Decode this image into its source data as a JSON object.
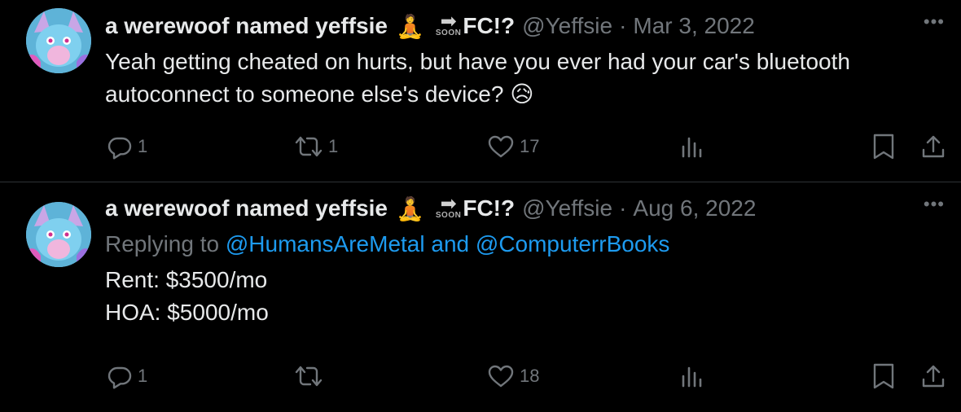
{
  "tweets": [
    {
      "display_name": "a werewoof named yeffsie",
      "name_emoji": "🧘",
      "soon_arrow": "➡",
      "soon_text": "SOON",
      "fc_text": "FC!?",
      "handle": "@Yeffsie",
      "separator": "·",
      "date": "Mar 3, 2022",
      "more": "•••",
      "text": "Yeah getting cheated on hurts, but have you ever had your car's bluetooth autoconnect to someone else's device? 😥",
      "replies": "1",
      "retweets": "1",
      "likes": "17"
    },
    {
      "display_name": "a werewoof named yeffsie",
      "name_emoji": "🧘",
      "soon_arrow": "➡",
      "soon_text": "SOON",
      "fc_text": "FC!?",
      "handle": "@Yeffsie",
      "separator": "·",
      "date": "Aug 6, 2022",
      "more": "•••",
      "replying_prefix": "Replying to ",
      "replying_mention_1": "@HumansAreMetal",
      "replying_and": " and ",
      "replying_mention_2": "@ComputerrBooks",
      "text_line_1": "Rent: $3500/mo",
      "text_line_2": "HOA: $5000/mo",
      "replies": "1",
      "retweets": "",
      "likes": "18"
    }
  ],
  "colors": {
    "background": "#000000",
    "primary_text": "#e7e9ea",
    "secondary_text": "#71767b",
    "link": "#1d9bf0",
    "divider": "#2f3336"
  },
  "icons": [
    "reply-icon",
    "retweet-icon",
    "like-icon",
    "views-icon",
    "bookmark-icon",
    "share-icon",
    "more-icon"
  ]
}
